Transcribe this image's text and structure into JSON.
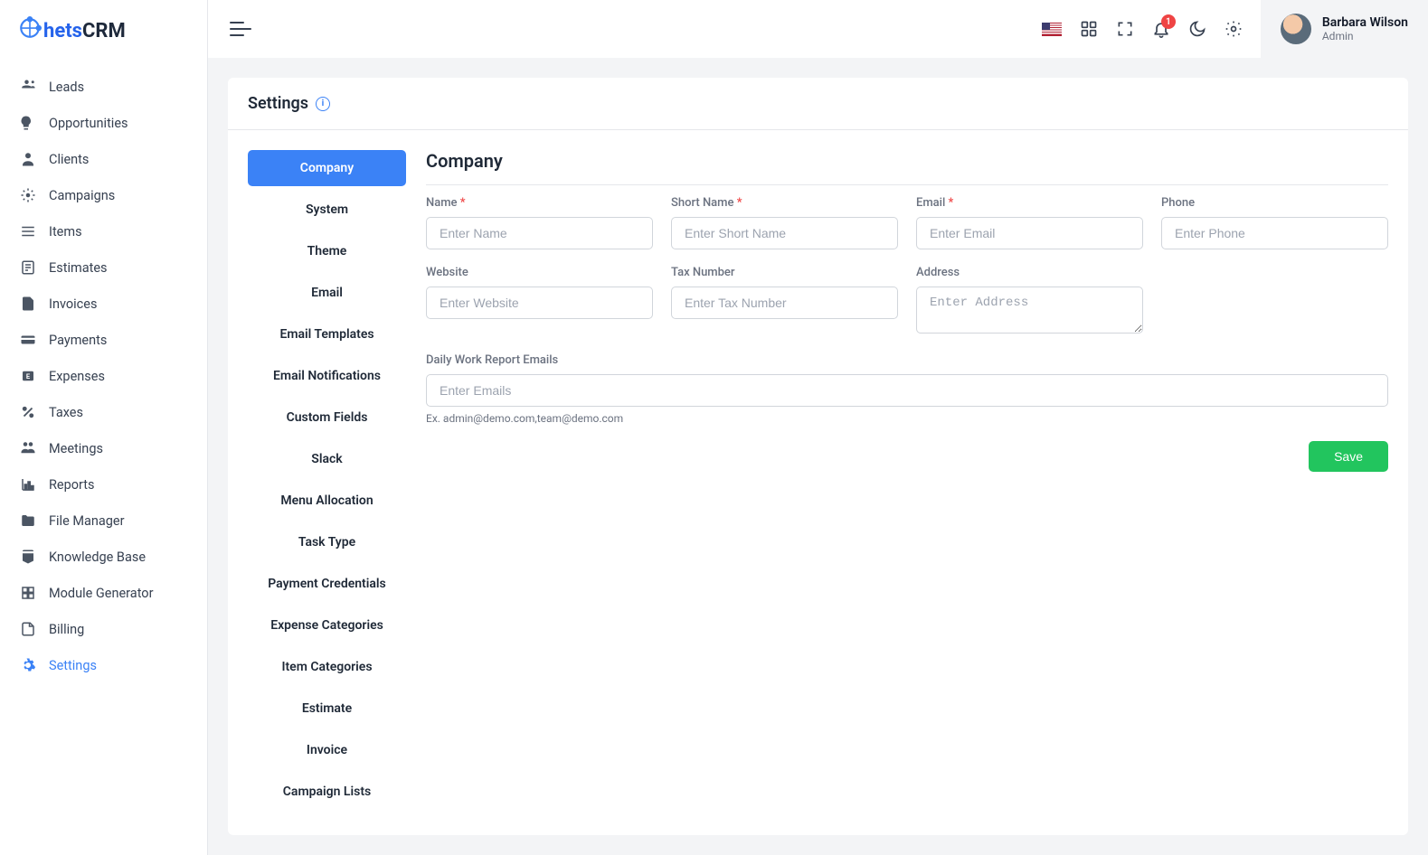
{
  "brand": {
    "part1": "hets",
    "part2": "CRM"
  },
  "sidebar": {
    "items": [
      {
        "label": "Leads"
      },
      {
        "label": "Opportunities"
      },
      {
        "label": "Clients"
      },
      {
        "label": "Campaigns"
      },
      {
        "label": "Items"
      },
      {
        "label": "Estimates"
      },
      {
        "label": "Invoices"
      },
      {
        "label": "Payments"
      },
      {
        "label": "Expenses"
      },
      {
        "label": "Taxes"
      },
      {
        "label": "Meetings"
      },
      {
        "label": "Reports"
      },
      {
        "label": "File Manager"
      },
      {
        "label": "Knowledge Base"
      },
      {
        "label": "Module Generator"
      },
      {
        "label": "Billing"
      },
      {
        "label": "Settings"
      }
    ]
  },
  "topbar": {
    "notification_count": "1",
    "user_name": "Barbara Wilson",
    "user_role": "Admin"
  },
  "page": {
    "title": "Settings",
    "info": "i"
  },
  "tabs": [
    {
      "label": "Company",
      "active": true
    },
    {
      "label": "System"
    },
    {
      "label": "Theme"
    },
    {
      "label": "Email"
    },
    {
      "label": "Email Templates"
    },
    {
      "label": "Email Notifications"
    },
    {
      "label": "Custom Fields"
    },
    {
      "label": "Slack"
    },
    {
      "label": "Menu Allocation"
    },
    {
      "label": "Task Type"
    },
    {
      "label": "Payment Credentials"
    },
    {
      "label": "Expense Categories"
    },
    {
      "label": "Item Categories"
    },
    {
      "label": "Estimate"
    },
    {
      "label": "Invoice"
    },
    {
      "label": "Campaign Lists"
    }
  ],
  "form": {
    "section_title": "Company",
    "asterisk": "*",
    "fields": {
      "name": {
        "label": "Name",
        "placeholder": "Enter Name",
        "required": true
      },
      "short_name": {
        "label": "Short Name",
        "placeholder": "Enter Short Name",
        "required": true
      },
      "email": {
        "label": "Email",
        "placeholder": "Enter Email",
        "required": true
      },
      "phone": {
        "label": "Phone",
        "placeholder": "Enter Phone"
      },
      "website": {
        "label": "Website",
        "placeholder": "Enter Website"
      },
      "tax_number": {
        "label": "Tax Number",
        "placeholder": "Enter Tax Number"
      },
      "address": {
        "label": "Address",
        "placeholder": "Enter Address"
      },
      "daily_emails": {
        "label": "Daily Work Report Emails",
        "placeholder": "Enter Emails",
        "hint": "Ex. admin@demo.com,team@demo.com"
      }
    },
    "actions": {
      "save": "Save"
    }
  }
}
